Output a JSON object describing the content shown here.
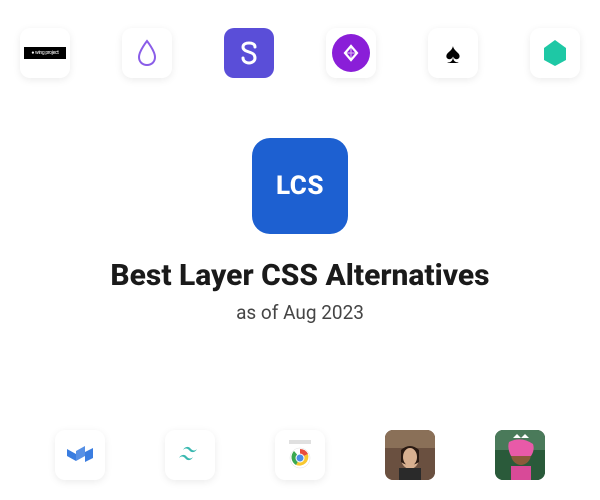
{
  "main": {
    "logo_text": "LCS",
    "title": "Best Layer CSS Alternatives",
    "subtitle": "as of Aug 2023"
  },
  "top_apps": [
    {
      "name": "wing-project"
    },
    {
      "name": "drop-framework"
    },
    {
      "name": "s-framework"
    },
    {
      "name": "diamond-framework"
    },
    {
      "name": "spade-framework"
    },
    {
      "name": "teal-framework"
    }
  ],
  "bottom_apps": [
    {
      "name": "mui"
    },
    {
      "name": "tailwind"
    },
    {
      "name": "chrome"
    },
    {
      "name": "avatar-person-1"
    },
    {
      "name": "avatar-person-2"
    }
  ]
}
